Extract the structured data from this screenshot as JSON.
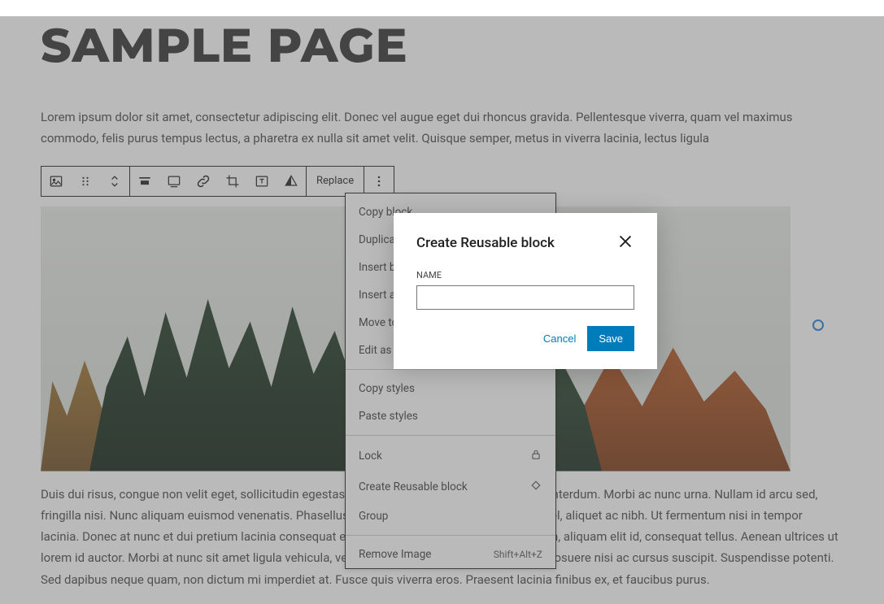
{
  "page": {
    "title": "SAMPLE PAGE",
    "paragraph1": "Lorem ipsum dolor sit amet, consectetur adipiscing elit. Donec vel augue eget dui rhoncus gravida. Pellentesque viverra, quam vel maximus commodo, felis purus tempus lectus, a pharetra ex nulla sit amet velit. Quisque semper, metus in viverra lacinia, lectus ligula",
    "paragraph2": "Duis dui risus, congue non velit eget, sollicitudin egestas purus. Aenean lacinia mi quis viverra interdum. Morbi ac nunc urna. Nullam id arcu sed, fringilla nisi. Nunc aliquam euismod venenatis. Phasellus tellus eros, tristique eget bibendum vel, aliquet ac nibh. Ut fermentum nisi in tempor lacinia. Donec at nunc et dui pretium lacinia consequat eget velit. In malesuada libero bibendum, aliquam elit id, consequat tellus. Aenean ultrices ut lorem id auctor. Morbi at nunc sit amet ligula vehicula, vel efficitur dolor interdum. Vestibulum posuere nisi ac cursus suscipit. Suspendisse potenti. Sed dapibus neque quam, non dictum mi imperdiet at. Fusce quis viverra eros. Praesent lacinia finibus ex, et faucibus purus."
  },
  "toolbar": {
    "replace": "Replace"
  },
  "menu": {
    "copy_block": "Copy block",
    "duplicate": "Duplicate",
    "insert_before": "Insert before",
    "insert_after": "Insert after",
    "move_to": "Move to",
    "edit_as_html": "Edit as HTML",
    "copy_styles": "Copy styles",
    "paste_styles": "Paste styles",
    "lock": "Lock",
    "create_reusable": "Create Reusable block",
    "group": "Group",
    "remove_image": "Remove Image",
    "remove_shortcut": "Shift+Alt+Z"
  },
  "modal": {
    "title": "Create Reusable block",
    "name_label": "NAME",
    "name_value": "",
    "cancel": "Cancel",
    "save": "Save"
  }
}
